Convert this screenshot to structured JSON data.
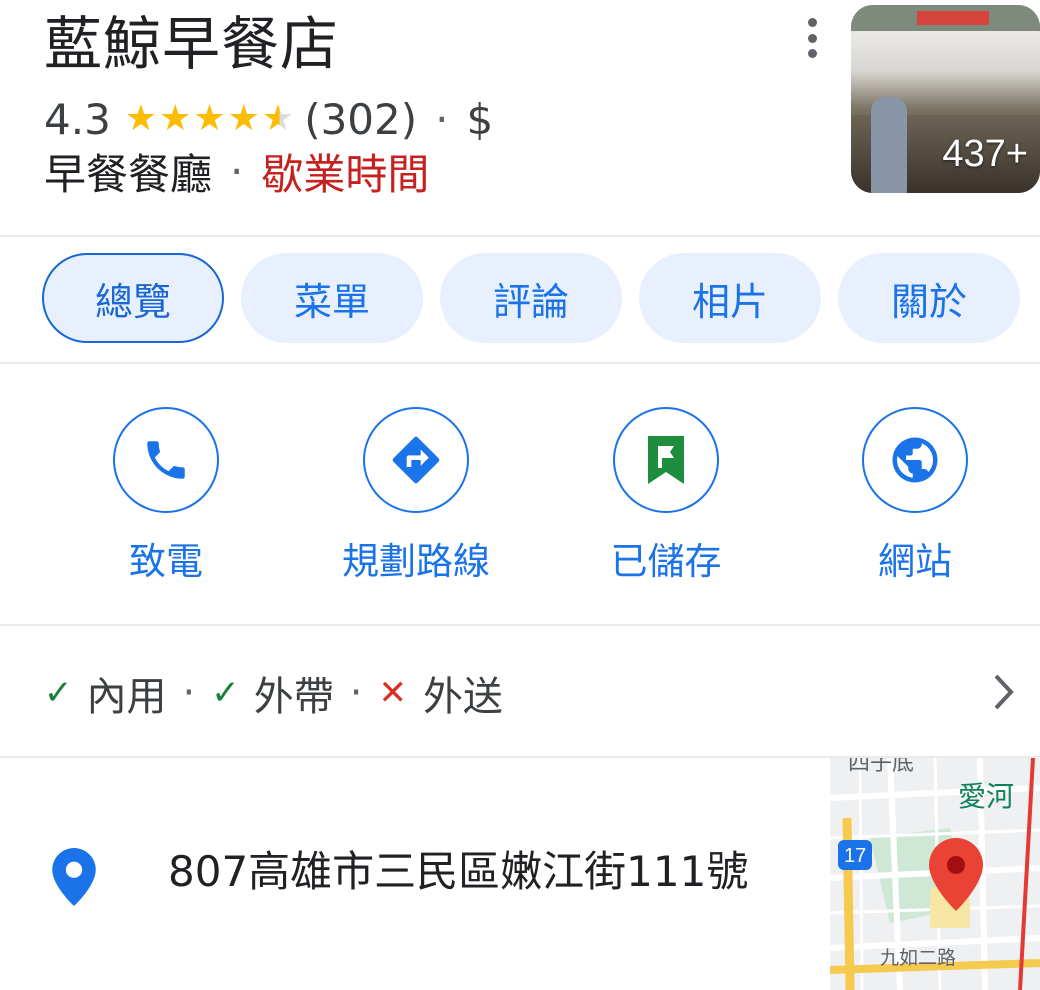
{
  "place": {
    "name": "藍鯨早餐店",
    "rating": "4.3",
    "rating_value": 4.3,
    "reviews": "(302)",
    "price": "$",
    "category": "早餐餐廳",
    "hours_label": "歇業時間",
    "photo_count": "437+"
  },
  "tabs": [
    "總覽",
    "菜單",
    "評論",
    "相片",
    "關於"
  ],
  "actions": {
    "call": "致電",
    "directions": "規劃路線",
    "saved": "已儲存",
    "website": "網站"
  },
  "service_options": {
    "dine_in": "內用",
    "takeout": "外帶",
    "delivery": "外送"
  },
  "address": "807高雄市三民區嫩江街111號",
  "map_labels": {
    "top": "四子底",
    "river": "愛河",
    "route": "17",
    "road": "九如二路"
  },
  "colors": {
    "accent": "#1a73e8",
    "closed": "#c5221f",
    "star": "#fbbc04",
    "saved": "#1e8e3e"
  }
}
